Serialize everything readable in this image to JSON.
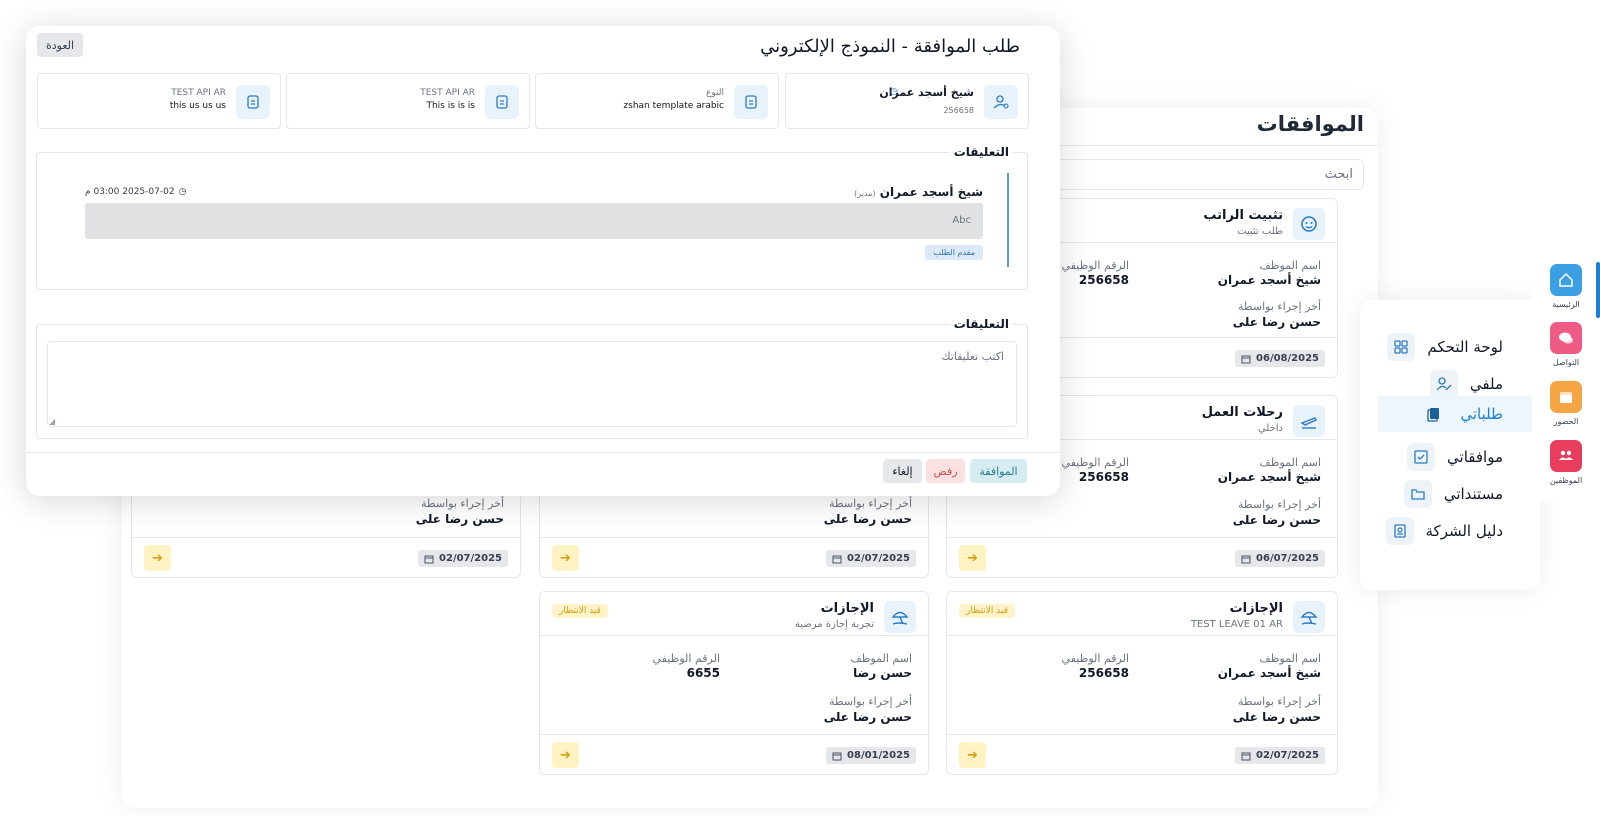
{
  "page": {
    "title": "الموافقات",
    "search_placeholder": "ابحث"
  },
  "cards": [
    {
      "title": "تثبيت الراتب",
      "subtitle": "طلب تثبيت",
      "icon": "baby-face-icon",
      "emp_label": "اسم الموظف",
      "emp_value": "شيخ أسجد عمران",
      "id_label": "الرقم الوظيفي",
      "id_value": "256658",
      "last_label": "أخر إجراء بواسطة",
      "last_value": "حسن رضا على",
      "date": "06/08/2025",
      "badge": ""
    },
    {
      "title": "رحلات العمل",
      "subtitle": "داخلي",
      "icon": "plane-icon",
      "emp_label": "اسم الموظف",
      "emp_value": "شيخ أسجد عمران",
      "id_label": "الرقم الوظيفي",
      "id_value": "256658",
      "last_label": "أخر إجراء بواسطة",
      "last_value": "حسن رضا على",
      "date": "06/07/2025",
      "badge": ""
    },
    {
      "last_label": "أخر إجراء بواسطة",
      "last_value": "حسن رضا على",
      "date": "02/07/2025"
    },
    {
      "last_label": "أخر إجراء بواسطة",
      "last_value": "حسن رضا على",
      "date": "02/07/2025"
    },
    {
      "title": "الإجازات",
      "subtitle": "TEST LEAVE 01 AR",
      "icon": "beach-umbrella-icon",
      "emp_label": "اسم الموظف",
      "emp_value": "شيخ أسجد عمران",
      "id_label": "الرقم الوظيفي",
      "id_value": "256658",
      "last_label": "أخر إجراء بواسطة",
      "last_value": "حسن رضا على",
      "date": "02/07/2025",
      "badge": "قيد الانتظار"
    },
    {
      "title": "الإجازات",
      "subtitle": "تجربة إجازة مرضية",
      "icon": "beach-umbrella-icon",
      "emp_label": "اسم الموظف",
      "emp_value": "حسن رضا",
      "id_label": "الرقم الوظيفي",
      "id_value": "6655",
      "last_label": "أخر إجراء بواسطة",
      "last_value": "حسن رضا على",
      "date": "08/01/2025",
      "badge": "قيد الانتظار"
    }
  ],
  "side_menu": {
    "items": [
      {
        "label": "لوحة التحكم",
        "icon": "grid-icon"
      },
      {
        "label": "ملفي",
        "icon": "user-edit-icon"
      },
      {
        "label": "طلباتي",
        "icon": "documents-icon"
      },
      {
        "label": "موافقاتي",
        "icon": "approval-icon"
      },
      {
        "label": "مستنداتي",
        "icon": "folder-icon"
      },
      {
        "label": "دليل الشركة",
        "icon": "id-card-icon"
      }
    ]
  },
  "rail": {
    "items": [
      {
        "label": "الرئيسية",
        "icon": "home-icon",
        "color": "#3b9fe3"
      },
      {
        "label": "التواصل",
        "icon": "chat-icon",
        "color": "#ee5c86"
      },
      {
        "label": "الحضور",
        "icon": "calendar-icon",
        "color": "#f6a545"
      },
      {
        "label": "الموظفين",
        "icon": "people-icon",
        "color": "#e83d5c"
      }
    ]
  },
  "modal": {
    "title": "طلب الموافقة - النموذج الإلكتروني",
    "back_label": "العودة",
    "info": [
      {
        "top": "شيخ أسجد عمران",
        "bottom": "256658",
        "icon": "user-icon"
      },
      {
        "top": "النوع",
        "bottom": "zshan template arabic",
        "icon": "document-icon"
      },
      {
        "top": "TEST API AR",
        "bottom": "This is is is",
        "icon": "document-icon"
      },
      {
        "top": "TEST API AR",
        "bottom": "this us us us",
        "icon": "document-icon"
      }
    ],
    "comments_title": "التعليقات",
    "comment": {
      "author": "شيخ أسجد عمران",
      "role": "(مدير)",
      "time": "2025-07-02 03:00 م",
      "body": "Abc",
      "tag": "مقدم الطلب"
    },
    "new_comment_title": "التعليقات",
    "new_comment_placeholder": "اكتب تعليقاتك",
    "approve_label": "الموافقة",
    "reject_label": "رفض",
    "cancel_label": "إلغاء"
  },
  "colors": {
    "accent": "#1d7fd4",
    "pending": "#d59d0f",
    "approve_bg": "#d7ecf1",
    "reject_bg": "#fbe1e1"
  }
}
